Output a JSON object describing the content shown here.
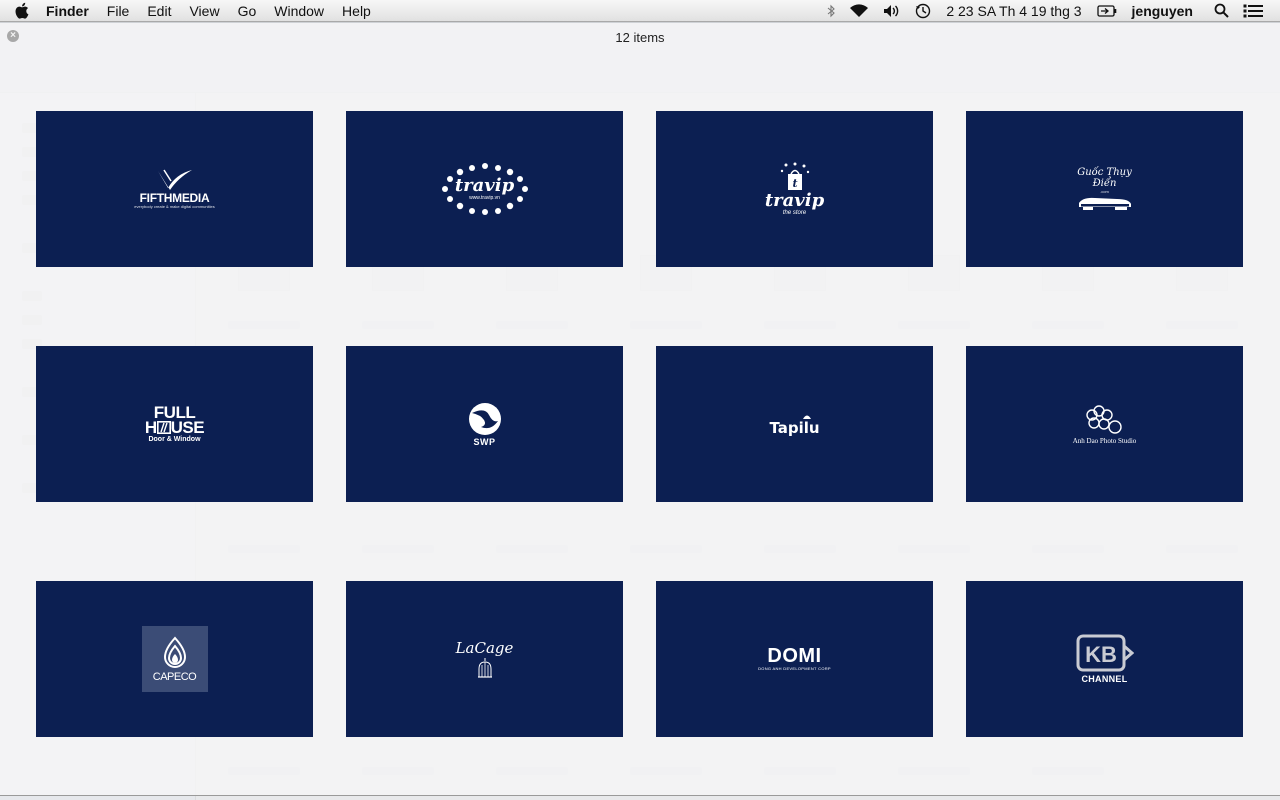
{
  "menubar": {
    "app_name": "Finder",
    "menus": [
      "File",
      "Edit",
      "View",
      "Go",
      "Window",
      "Help"
    ],
    "status_icons": [
      "bluetooth-icon",
      "wifi-icon",
      "volume-icon",
      "time-machine-icon"
    ],
    "clock": "2 23 SA Th 4 19 thg 3",
    "user": "jenguyen"
  },
  "quicklook": {
    "title": "12 items",
    "background_color": "#0c1f52",
    "items": [
      {
        "id": "fifthmedia",
        "text": "FIFTHMEDIA",
        "sub": "everybody create & make digital communities"
      },
      {
        "id": "travip-oval",
        "text": "travip",
        "sub": "www.travip.vn"
      },
      {
        "id": "travip-store",
        "text": "travip",
        "sub": "the store"
      },
      {
        "id": "guoc-thuy-dien",
        "text": "Guốc Thụy Điển",
        "sub": ".com"
      },
      {
        "id": "fullhouse",
        "text": "FULL",
        "text2": "H",
        "text3": "USE",
        "sub": "Door & Window"
      },
      {
        "id": "swp",
        "text": "SWP"
      },
      {
        "id": "tapilu",
        "text": "Tapilu"
      },
      {
        "id": "anh-dao",
        "text": "Anh Dao",
        "sub": "Anh Dao Photo Studio"
      },
      {
        "id": "capeco",
        "text": "CAPECO"
      },
      {
        "id": "lacage",
        "text": "LaCage"
      },
      {
        "id": "domi",
        "text": "DOMI",
        "sub": "DONG ANH DEVELOPMENT CORP"
      },
      {
        "id": "kb-channel",
        "text": "CHANNEL"
      }
    ]
  }
}
